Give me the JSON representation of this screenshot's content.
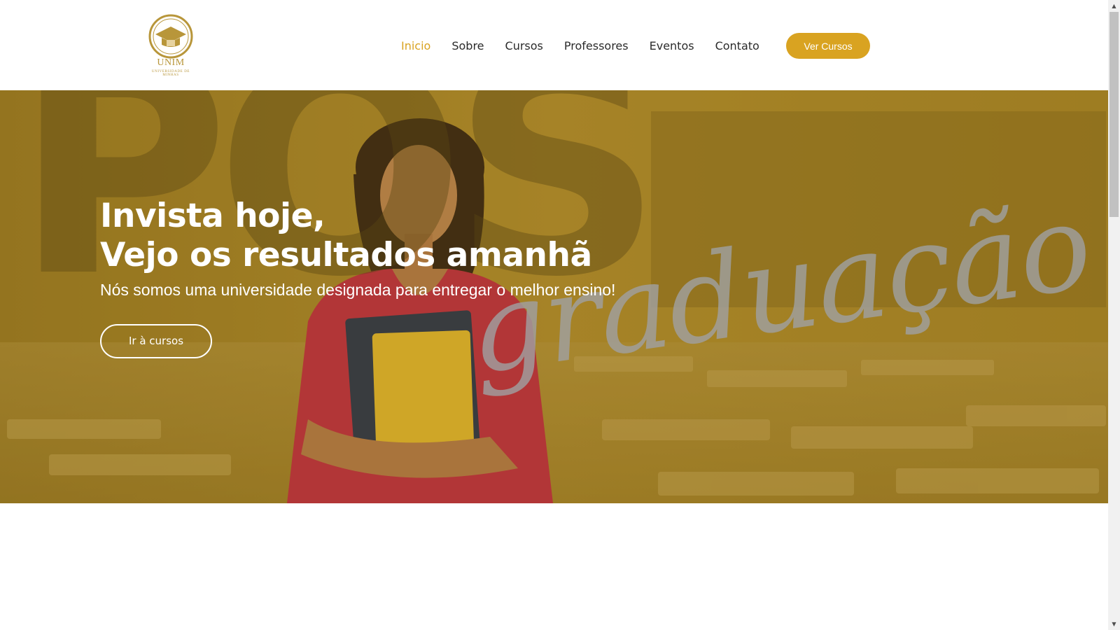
{
  "logo": {
    "name": "UNIM",
    "subtitle": "UNIVERSIDADE DE MINHAS",
    "icon": "graduation-cap-icon"
  },
  "nav": {
    "items": [
      {
        "label": "Inicio",
        "active": true
      },
      {
        "label": "Sobre",
        "active": false
      },
      {
        "label": "Cursos",
        "active": false
      },
      {
        "label": "Professores",
        "active": false
      },
      {
        "label": "Eventos",
        "active": false
      },
      {
        "label": "Contato",
        "active": false
      }
    ],
    "cta_label": "Ver Cursos"
  },
  "hero": {
    "title_line1": "Invista hoje,",
    "title_line2": "Vejo os resultados amanhã",
    "subtitle": "Nós somos uma universidade designada para entregar o melhor ensino!",
    "button_label": "Ir à cursos",
    "background_word_top": "PÓS",
    "background_word_script": "graduação"
  },
  "colors": {
    "accent": "#d9a321",
    "hero_overlay": "#9c7a21",
    "nav_text": "#2b2b2b",
    "logo": "#b8963a"
  },
  "scrollbar": {
    "up_icon": "arrow-up-icon",
    "down_icon": "arrow-down-icon"
  }
}
